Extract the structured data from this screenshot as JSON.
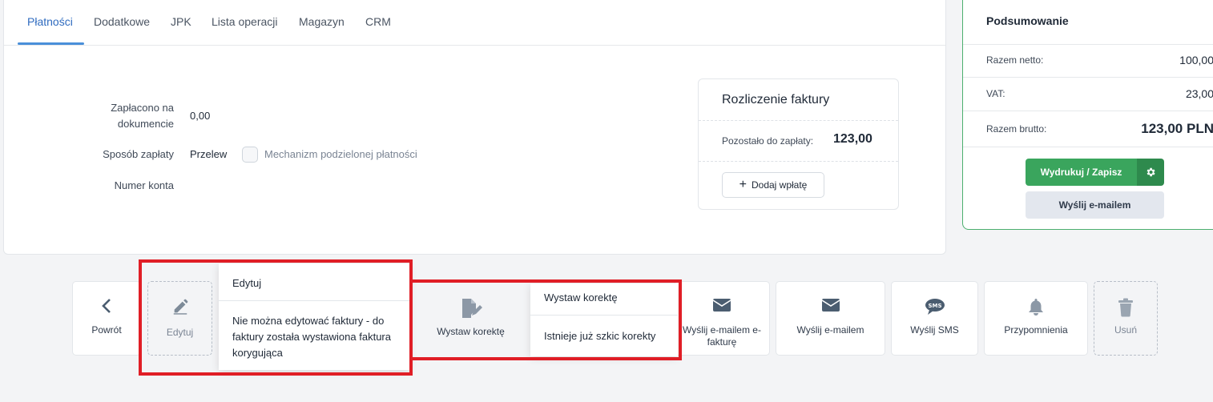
{
  "tabs": [
    {
      "label": "Płatności",
      "active": true
    },
    {
      "label": "Dodatkowe"
    },
    {
      "label": "JPK"
    },
    {
      "label": "Lista operacji"
    },
    {
      "label": "Magazyn"
    },
    {
      "label": "CRM"
    }
  ],
  "payment": {
    "paid_label": "Zapłacono na dokumencie",
    "paid_value": "0,00",
    "method_label": "Sposób zapłaty",
    "method_value": "Przelew",
    "split_label": "Mechanizm podzielonej płatności",
    "account_label": "Numer konta"
  },
  "settlement": {
    "title": "Rozliczenie faktury",
    "remaining_label": "Pozostało do zapłaty:",
    "remaining_value": "123,00",
    "add_payment": "Dodaj wpłatę"
  },
  "summary": {
    "title": "Podsumowanie",
    "net_label": "Razem netto:",
    "net_value": "100,00",
    "vat_label": "VAT:",
    "vat_value": "23,00",
    "gross_label": "Razem brutto:",
    "gross_value": "123,00 PLN",
    "print_button": "Wydrukuj / Zapisz",
    "email_button": "Wyślij e-mailem"
  },
  "actions": {
    "back": "Powrót",
    "edit": "Edytuj",
    "correction": "Wystaw korektę",
    "send_einvoice": "Wyślij e-mailem e-fakturę",
    "send_email": "Wyślij e-mailem",
    "send_sms": "Wyślij SMS",
    "reminders": "Przypomnienia",
    "delete": "Usuń"
  },
  "tooltips": {
    "edit_title": "Edytuj",
    "edit_body": "Nie można edytować faktury - do faktury została wystawiona faktura korygująca",
    "correction_title": "Wystaw korektę",
    "correction_body": "Istnieje już szkic korekty"
  },
  "colors": {
    "accent": "#2f6bbf",
    "primary_green": "#3aa55d",
    "highlight_red": "#e01e26"
  }
}
